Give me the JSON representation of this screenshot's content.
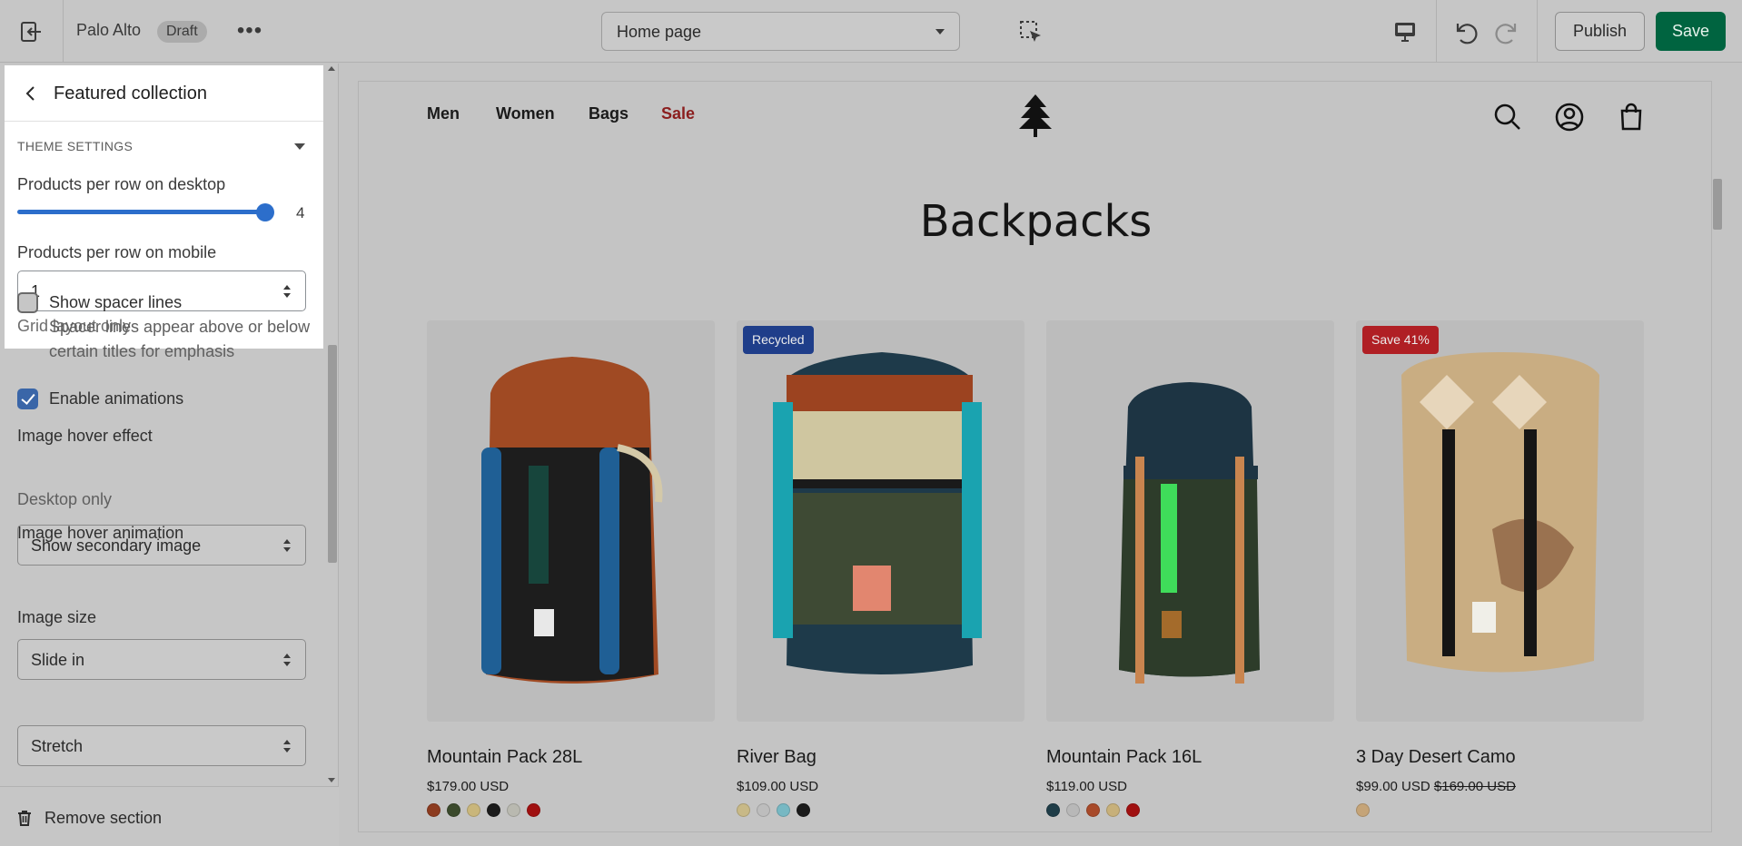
{
  "topbar": {
    "store_name": "Palo Alto",
    "status_badge": "Draft",
    "more_label": "•••",
    "page_select": "Home page",
    "publish_label": "Publish",
    "save_label": "Save"
  },
  "sidebar": {
    "section_title": "Featured collection",
    "group_label": "THEME SETTINGS",
    "desktop_row_label": "Products per row on desktop",
    "desktop_row_value": "4",
    "desktop_row_fraction": 1.0,
    "mobile_row_label": "Products per row on mobile",
    "mobile_row_value": "1",
    "mobile_row_help": "Grid layout only",
    "spacer_label": "Show spacer lines",
    "spacer_help": "Spacer lines appear above or below certain titles for emphasis",
    "spacer_checked": false,
    "animations_label": "Enable animations",
    "animations_checked": true,
    "hover_effect_label": "Image hover effect",
    "hover_effect_value": "Show secondary image",
    "hover_effect_help": "Desktop only",
    "hover_animation_label": "Image hover animation",
    "hover_animation_value": "Slide in",
    "image_size_label": "Image size",
    "image_size_value": "Stretch",
    "remove_label": "Remove section"
  },
  "preview": {
    "nav": [
      "Men",
      "Women",
      "Bags",
      "Sale"
    ],
    "collection_title": "Backpacks",
    "products": [
      {
        "name": "Mountain Pack 28L",
        "price": "$179.00 USD",
        "compare": "",
        "badge": "",
        "swatches": [
          "#8c3b1f",
          "#3b4a2c",
          "#c9b67b",
          "#1b1b1b",
          "#b9b9b0",
          "#a01010"
        ]
      },
      {
        "name": "River Bag",
        "price": "$109.00 USD",
        "compare": "",
        "badge": "Recycled",
        "swatches": [
          "#c8b987",
          "#bdbdbd",
          "#77b8c3",
          "#1b1b1b"
        ]
      },
      {
        "name": "Mountain Pack 16L",
        "price": "$119.00 USD",
        "compare": "",
        "badge": "",
        "swatches": [
          "#1f3d48",
          "#b8b8b8",
          "#a84a2a",
          "#c7b07a",
          "#a01010"
        ]
      },
      {
        "name": "3 Day Desert Camo",
        "price": "$99.00 USD",
        "compare": "$169.00 USD",
        "badge": "Save 41%",
        "swatches": [
          "#c5a478"
        ]
      }
    ]
  },
  "colors": {
    "accent_blue": "#2c6ecb",
    "save_green": "#006440",
    "sale_red": "#8b1e1e"
  }
}
